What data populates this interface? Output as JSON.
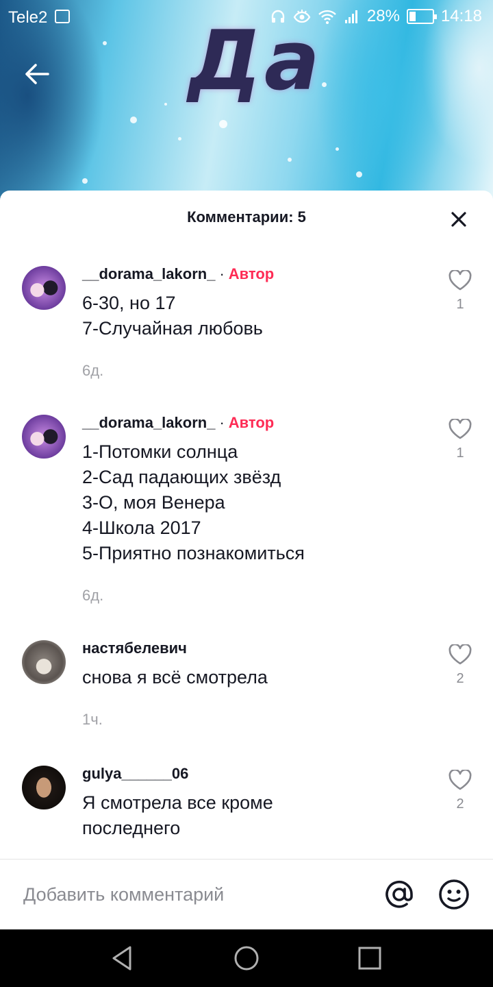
{
  "status_bar": {
    "carrier": "Tele2",
    "battery": "28%",
    "time": "14:18",
    "battery_level": 0.28
  },
  "video": {
    "caption": "Да"
  },
  "sheet": {
    "title": "Комментарии: 5"
  },
  "comments": [
    {
      "username": "__dorama_lakorn_",
      "dot": "·",
      "badge": "Автор",
      "lines": [
        "6-30, но 17",
        "7-Случайная любовь"
      ],
      "time": "6д.",
      "likes": "1"
    },
    {
      "username": "__dorama_lakorn_",
      "dot": "·",
      "badge": "Автор",
      "lines": [
        "1-Потомки солнца",
        "2-Сад падающих звёзд",
        "3-О, моя Венера",
        "4-Школа 2017",
        "5-Приятно познакомиться"
      ],
      "time": "6д.",
      "likes": "1"
    },
    {
      "username": "настябелевич",
      "lines": [
        "снова я всё смотрела"
      ],
      "time": "1ч.",
      "likes": "2"
    },
    {
      "username": "gulya______06",
      "lines": [
        "Я смотрела все кроме",
        "последнего"
      ],
      "likes": "2"
    }
  ],
  "input": {
    "placeholder": "Добавить комментарий"
  },
  "icons": {
    "back": "arrow-left-icon",
    "close": "close-icon",
    "like": "heart-outline-icon",
    "mention": "at-sign-icon",
    "emoji": "smiley-icon",
    "nav_back": "triangle-back-icon",
    "nav_home": "circle-home-icon",
    "nav_recents": "square-recents-icon"
  },
  "colors": {
    "author_badge": "#fe2c55",
    "text_primary": "#161823",
    "text_secondary": "#a0a1a6"
  }
}
